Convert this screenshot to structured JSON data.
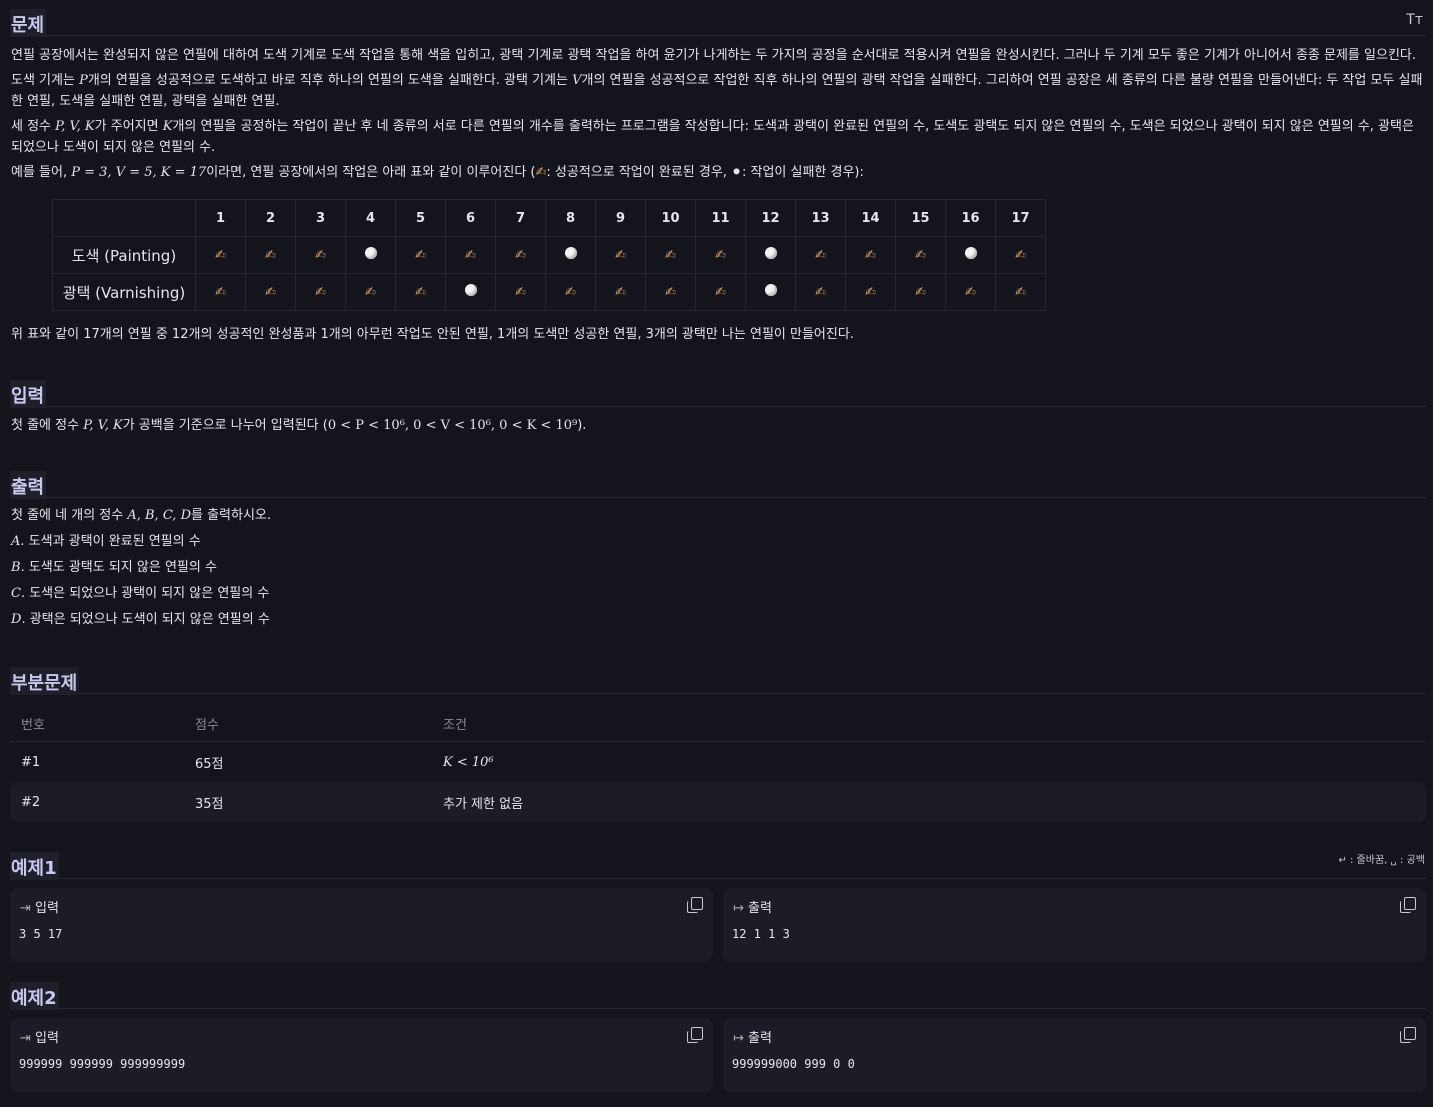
{
  "problem": {
    "title": "문제",
    "font_toggle": "Tт",
    "p1": "연필 공장에서는 완성되지 않은 연필에 대하여 도색 기계로 도색 작업을 통해 색을 입히고, 광택 기계로 광택 작업을 하여 윤기가 나게하는 두 가지의 공정을 순서대로 적용시켜 연필을 완성시킨다. 그러나 두 기계 모두 좋은 기계가 아니어서 종종 문제를 일으킨다.",
    "p2a": "도색 기계는 ",
    "p2_var1": "P",
    "p2b": "개의 연필을 성공적으로 도색하고 바로 직후 하나의 연필의 도색을 실패한다. 광택 기계는 ",
    "p2_var2": "V",
    "p2c": "개의 연필을 성공적으로 작업한 직후 하나의 연필의 광택 작업을 실패한다. 그리하여 연필 공장은 세 종류의 다른 불량 연필을 만들어낸다: 두 작업 모두 실패한 연필, 도색을 실패한 연필, 광택을 실패한 연필.",
    "p3a": "세 정수 ",
    "p3_vars": "P, V, K",
    "p3b": "가 주어지면 ",
    "p3_var": "K",
    "p3c": "개의 연필을 공정하는 작업이 끝난 후 네 종류의 서로 다른 연필의 개수를 출력하는 프로그램을 작성합니다: 도색과 광택이 완료된 연필의 수, 도색도 광택도 되지 않은 연필의 수, 도색은 되었으나 광택이 되지 않은 연필의 수, 광택은 되었으나 도색이 되지 않은 연필의 수.",
    "p4a": "예를 들어, ",
    "p4_math": "P = 3, V = 5, K = 17",
    "p4b": "이라면, 연필 공장에서의 작업은 아래 표와 같이 이루어진다 (",
    "p4_ok": "✍",
    "p4c": ": 성공적으로 작업이 완료된 경우, ",
    "p4_fail": "⚫",
    "p4d": ": 작업이 실패한 경우):",
    "p5": "위 표와 같이 17개의 연필 중 12개의 성공적인 완성품과 1개의 아무런 작업도 안된 연필, 1개의 도색만 성공한 연필, 3개의 광택만 나는 연필이 만들어진다."
  },
  "table": {
    "columns": [
      "1",
      "2",
      "3",
      "4",
      "5",
      "6",
      "7",
      "8",
      "9",
      "10",
      "11",
      "12",
      "13",
      "14",
      "15",
      "16",
      "17"
    ],
    "rows": [
      {
        "label": "도색 (Painting)",
        "cells": [
          "ok",
          "ok",
          "ok",
          "fail",
          "ok",
          "ok",
          "ok",
          "fail",
          "ok",
          "ok",
          "ok",
          "fail",
          "ok",
          "ok",
          "ok",
          "fail",
          "ok"
        ]
      },
      {
        "label": "광택 (Varnishing)",
        "cells": [
          "ok",
          "ok",
          "ok",
          "ok",
          "ok",
          "fail",
          "ok",
          "ok",
          "ok",
          "ok",
          "ok",
          "fail",
          "ok",
          "ok",
          "ok",
          "ok",
          "ok"
        ]
      }
    ]
  },
  "input": {
    "title": "입력",
    "a": "첫 줄에 정수 ",
    "vars": "P, V, K",
    "b": "가 공백을 기준으로 나누어 입력된다 (",
    "constraint": "0 < P < 10⁶, 0 < V < 10⁶, 0 < K < 10⁹",
    "c": ")."
  },
  "output": {
    "title": "출력",
    "a": "첫 줄에 네 개의 정수 ",
    "vars": "A, B, C, D",
    "b": "를  출력하시오.",
    "items": [
      {
        "var": "A",
        "text": ". 도색과 광택이 완료된 연필의 수"
      },
      {
        "var": "B",
        "text": ". 도색도 광택도 되지 않은 연필의 수"
      },
      {
        "var": "C",
        "text": ". 도색은 되었으나 광택이 되지 않은 연필의 수"
      },
      {
        "var": "D",
        "text": ". 광택은 되었으나 도색이 되지 않은 연필의 수"
      }
    ]
  },
  "subtasks": {
    "title": "부분문제",
    "headers": [
      "번호",
      "점수",
      "조건"
    ],
    "rows": [
      {
        "num": "#1",
        "score": "65점",
        "cond": "K < 10⁶"
      },
      {
        "num": "#2",
        "score": "35점",
        "cond": "추가 제한 없음"
      }
    ]
  },
  "legend": "↵ : 줄바꿈,  ␣ : 공백",
  "examples": [
    {
      "title": "예제1",
      "in_label": "입력",
      "in_value": "3 5 17",
      "out_label": "출력",
      "out_value": "12 1 1 3"
    },
    {
      "title": "예제2",
      "in_label": "입력",
      "in_value": "999999 999999 999999999",
      "out_label": "출력",
      "out_value": "999999000 999 0 0"
    }
  ],
  "colors": {
    "background": "#14141c",
    "section_title": "#c9c9f0",
    "box": "#1c1c26"
  }
}
